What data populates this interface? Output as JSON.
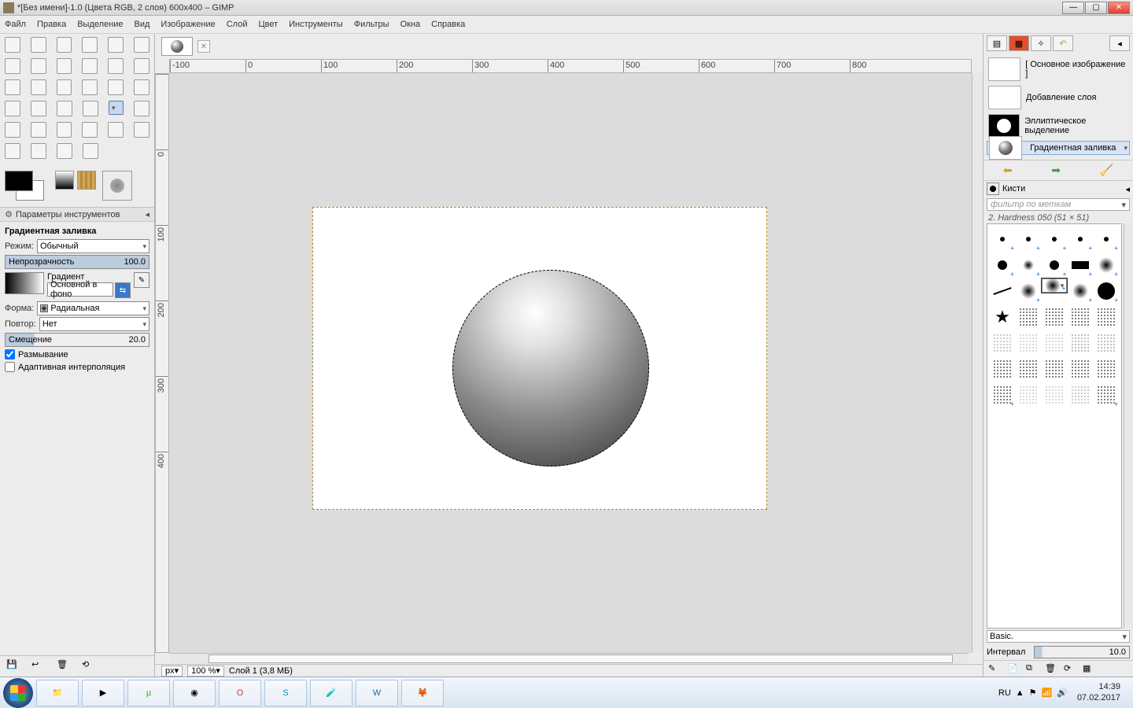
{
  "title": "*[Без имени]-1.0 (Цвета RGB, 2 слоя) 600x400 – GIMP",
  "menu": [
    "Файл",
    "Правка",
    "Выделение",
    "Вид",
    "Изображение",
    "Слой",
    "Цвет",
    "Инструменты",
    "Фильтры",
    "Окна",
    "Справка"
  ],
  "tooloptions": {
    "panel_title": "Параметры инструментов",
    "tool_name": "Градиентная заливка",
    "mode_label": "Режим:",
    "mode_value": "Обычный",
    "opacity_label": "Непрозрачность",
    "opacity_value": "100.0",
    "gradient_label": "Градиент",
    "gradient_name": "Основной в фоно",
    "shape_label": "Форма:",
    "shape_value": "Радиальная",
    "repeat_label": "Повтор:",
    "repeat_value": "Нет",
    "offset_label": "Смещение",
    "offset_value": "20.0",
    "dither": "Размывание",
    "adaptive": "Адаптивная интерполяция"
  },
  "history": [
    {
      "label": "[ Основное изображение ]"
    },
    {
      "label": "Добавление слоя"
    },
    {
      "label": "Эллиптическое выделение"
    },
    {
      "label": "Градиентная заливка"
    }
  ],
  "brushes": {
    "title": "Кисти",
    "filter_placeholder": "фильтр по меткам",
    "current": "2. Hardness 050 (51 × 51)",
    "preset": "Basic.",
    "interval_label": "Интервал",
    "interval_value": "10.0"
  },
  "status": {
    "unit": "px",
    "zoom": "100 %",
    "layer": "Слой 1 (3,8 МБ)"
  },
  "rulerH": [
    "-100",
    "0",
    "100",
    "200",
    "300",
    "400",
    "500",
    "600",
    "700",
    "800"
  ],
  "rulerV": [
    "0",
    "100",
    "200",
    "300",
    "400"
  ],
  "taskbar": {
    "lang": "RU",
    "time": "14:39",
    "date": "07.02.2017"
  }
}
